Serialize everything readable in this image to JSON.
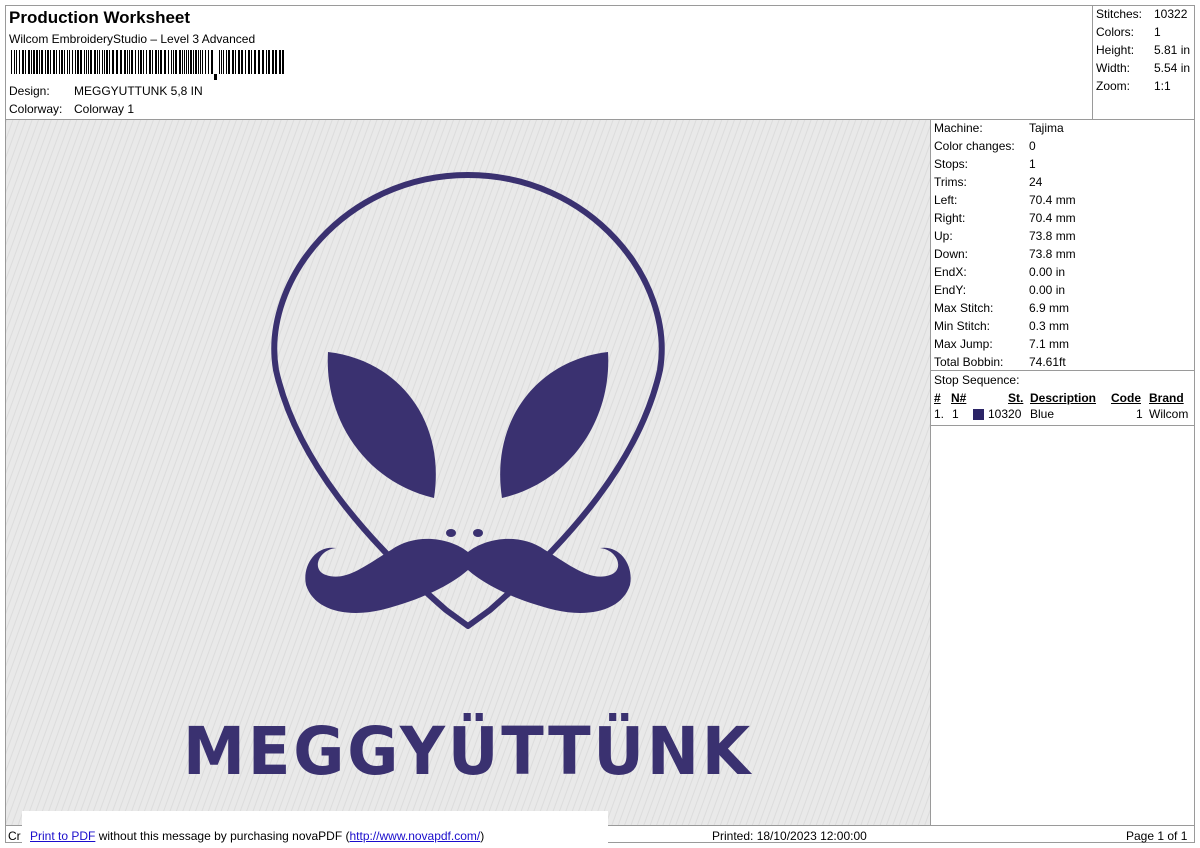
{
  "header": {
    "title": "Production Worksheet",
    "software": "Wilcom EmbroideryStudio – Level 3 Advanced",
    "design_label": "Design:",
    "design_value": "MEGGYUTTUNK 5,8 IN",
    "colorway_label": "Colorway:",
    "colorway_value": "Colorway 1"
  },
  "summary": [
    {
      "label": "Stitches:",
      "value": "10322"
    },
    {
      "label": "Colors:",
      "value": "1"
    },
    {
      "label": "Height:",
      "value": "5.81 in"
    },
    {
      "label": "Width:",
      "value": "5.54 in"
    },
    {
      "label": "Zoom:",
      "value": "1:1"
    }
  ],
  "machine_info": [
    {
      "label": "Machine:",
      "value": "Tajima"
    },
    {
      "label": "Color changes:",
      "value": "0"
    },
    {
      "label": "Stops:",
      "value": "1"
    },
    {
      "label": "Trims:",
      "value": "24"
    },
    {
      "label": "Left:",
      "value": "70.4 mm"
    },
    {
      "label": "Right:",
      "value": "70.4 mm"
    },
    {
      "label": "Up:",
      "value": "73.8 mm"
    },
    {
      "label": "Down:",
      "value": "73.8 mm"
    },
    {
      "label": "EndX:",
      "value": "0.00 in"
    },
    {
      "label": "EndY:",
      "value": "0.00 in"
    },
    {
      "label": "Max Stitch:",
      "value": "6.9 mm"
    },
    {
      "label": "Min Stitch:",
      "value": "0.3 mm"
    },
    {
      "label": "Max Jump:",
      "value": "7.1 mm"
    },
    {
      "label": "Total Bobbin:",
      "value": "74.61ft"
    }
  ],
  "stop_sequence": {
    "title": "Stop Sequence:",
    "headers": {
      "num": "#",
      "n": "N#",
      "st": "St.",
      "description": "Description",
      "code": "Code",
      "brand": "Brand"
    },
    "rows": [
      {
        "num": "1.",
        "n": "1",
        "st": "10320",
        "description": "Blue",
        "code": "1",
        "brand": "Wilcom",
        "color": "#2b2466"
      }
    ]
  },
  "design": {
    "text": "MEGGYÜTTÜNK",
    "thread_color": "#3a3170",
    "background_color": "#e9e9e9"
  },
  "footer": {
    "left_fragment": "Cr",
    "print_link": "Print to PDF",
    "message": "without this message by purchasing novaPDF (",
    "url": "http://www.novapdf.com/",
    "close": ")",
    "printed": "Printed: 18/10/2023 12:00:00",
    "page": "Page 1 of 1"
  }
}
